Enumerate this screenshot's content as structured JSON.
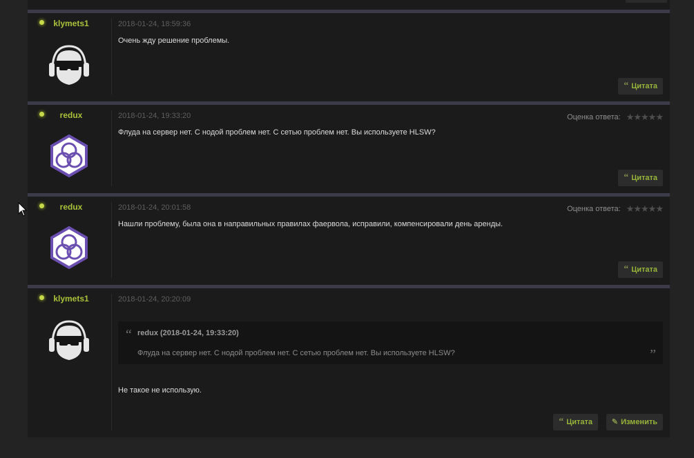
{
  "posts": [
    {
      "author": "klymets1",
      "avatar_icon": "headphone-sunglasses-avatar-icon",
      "date": "2018-01-24, 18:59:36",
      "message": "Очень жду решение проблемы.",
      "quote_label": "Цитата"
    },
    {
      "author": "redux",
      "avatar_icon": "hexagon-knot-avatar-icon",
      "date": "2018-01-24, 19:33:20",
      "rating_label": "Оценка ответа:",
      "rating_stars": "★★★★★",
      "message": "Флуда на сервер нет. С нодой проблем нет. С сетью проблем нет. Вы используете HLSW?",
      "quote_label": "Цитата"
    },
    {
      "author": "redux",
      "avatar_icon": "hexagon-knot-avatar-icon",
      "date": "2018-01-24, 20:01:58",
      "rating_label": "Оценка ответа:",
      "rating_stars": "★★★★★",
      "message": "Нашли проблему, была она в направильных правилах фаервола, исправили, компенсировали день аренды.",
      "quote_label": "Цитата"
    },
    {
      "author": "klymets1",
      "avatar_icon": "headphone-sunglasses-avatar-icon",
      "date": "2018-01-24, 20:20:09",
      "quote": {
        "author": "redux (2018-01-24, 19:33:20)",
        "text": "Флуда на сервер нет. С нодой проблем нет. С сетью проблем нет. Вы используете HLSW?"
      },
      "message": "Не такое не использую.",
      "quote_label": "Цитата",
      "edit_label": "Изменить"
    }
  ],
  "icons": {
    "quote_glyph": "“",
    "pencil_glyph": "✎"
  },
  "colors": {
    "accent_green": "#a9c23a",
    "separator": "#3b3b4a",
    "avatar_purple": "#6b4fb0"
  }
}
